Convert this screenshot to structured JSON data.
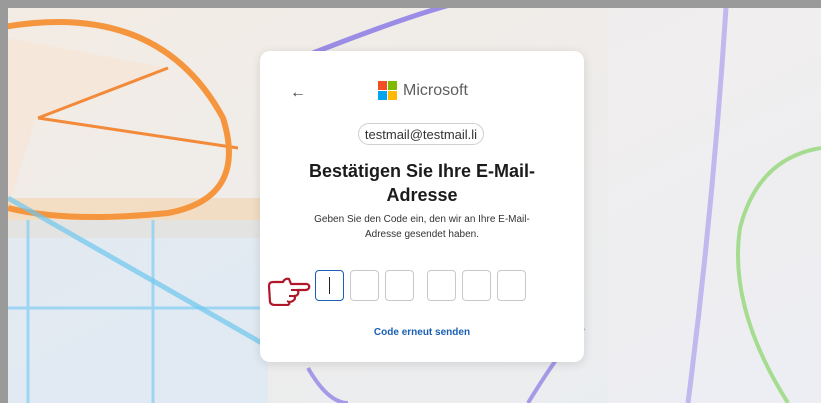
{
  "card": {
    "back_icon": "back-arrow-icon",
    "logo_text": "Microsoft",
    "logo_colors": [
      "#f25022",
      "#7fba00",
      "#00a4ef",
      "#ffb900"
    ],
    "email": "testmail@testmail.li",
    "title": "Bestätigen Sie Ihre E-Mail-Adresse",
    "description": "Geben Sie den Code ein, den wir an Ihre E-Mail-Adresse gesendet haben.",
    "code_digits": [
      "",
      "",
      "",
      "",
      "",
      ""
    ],
    "active_digit": 1,
    "resend_label": "Code erneut senden"
  },
  "annotation": {
    "icon": "pointing-hand-icon",
    "color": "#b0182a"
  },
  "colors": {
    "link": "#1a5fb4",
    "background": "#eef0f3"
  }
}
